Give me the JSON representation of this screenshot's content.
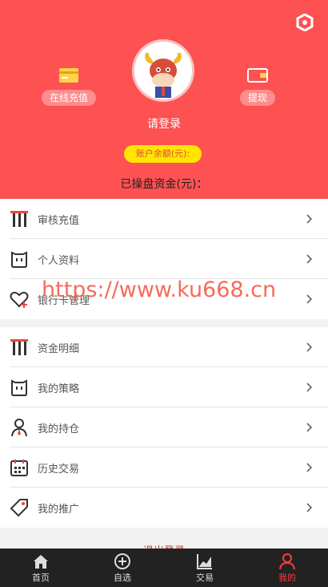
{
  "colors": {
    "header_bg": "#fd5152",
    "balance_bg": "#ffe600",
    "accent": "#ff3b3b",
    "tabbar_bg": "#222222",
    "watermark": "#f55b4a"
  },
  "header": {
    "settings_icon": "hexagon-settings-icon",
    "recharge_label": "在线充值",
    "withdraw_label": "提现",
    "login_text": "请登录",
    "balance_label": "账户余额(元):",
    "trade_funds_label": "已操盘资金(元)："
  },
  "menu_group_1": [
    {
      "label": "审核充值",
      "icon": "recharge-review-icon"
    },
    {
      "label": "个人资料",
      "icon": "profile-icon"
    },
    {
      "label": "银行卡管理",
      "icon": "bank-card-heart-icon"
    }
  ],
  "menu_group_2": [
    {
      "label": "资金明细",
      "icon": "funds-detail-icon"
    },
    {
      "label": "我的策略",
      "icon": "strategy-icon"
    },
    {
      "label": "我的持仓",
      "icon": "position-icon"
    },
    {
      "label": "历史交易",
      "icon": "calendar-icon"
    },
    {
      "label": "我的推广",
      "icon": "tag-icon"
    }
  ],
  "watermark": "https://www.ku668.cn",
  "logout_label": "退出登录",
  "tabbar": [
    {
      "label": "首页",
      "icon": "home-icon",
      "active": false
    },
    {
      "label": "自选",
      "icon": "plus-circle-icon",
      "active": false
    },
    {
      "label": "交易",
      "icon": "chart-icon",
      "active": false
    },
    {
      "label": "我的",
      "icon": "user-icon",
      "active": true
    }
  ]
}
